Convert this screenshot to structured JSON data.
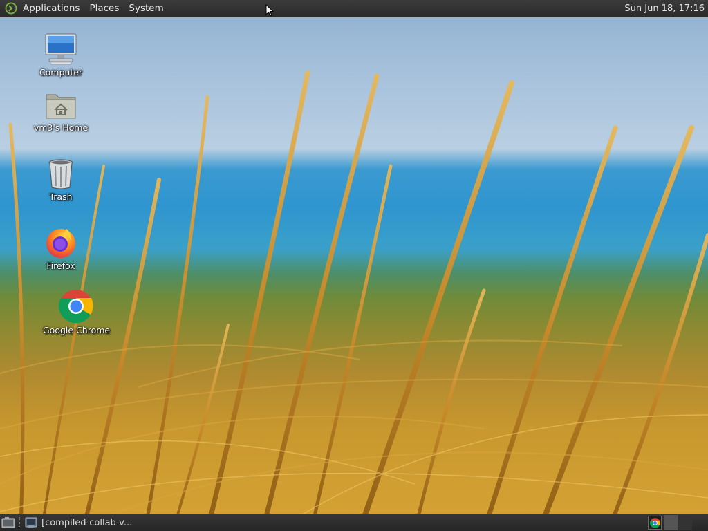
{
  "top_panel": {
    "menus": [
      {
        "label": "Applications"
      },
      {
        "label": "Places"
      },
      {
        "label": "System"
      }
    ],
    "clock": "Sun Jun 18, 17:16"
  },
  "desktop_icons": [
    {
      "label": "Computer",
      "icon": "computer-icon"
    },
    {
      "label": "vm3's Home",
      "icon": "home-folder-icon"
    },
    {
      "label": "Trash",
      "icon": "trash-icon"
    },
    {
      "label": "Firefox",
      "icon": "firefox-icon"
    },
    {
      "label": "Google Chrome",
      "icon": "chrome-icon"
    }
  ],
  "bottom_panel": {
    "task_label": "[compiled-collab-v..."
  },
  "colors": {
    "panel_bg": "#2b2b2b",
    "panel_text": "#e8e8e8",
    "sky": "#a9c3dd",
    "sea": "#2f95cf",
    "grass": "#c9982e"
  }
}
